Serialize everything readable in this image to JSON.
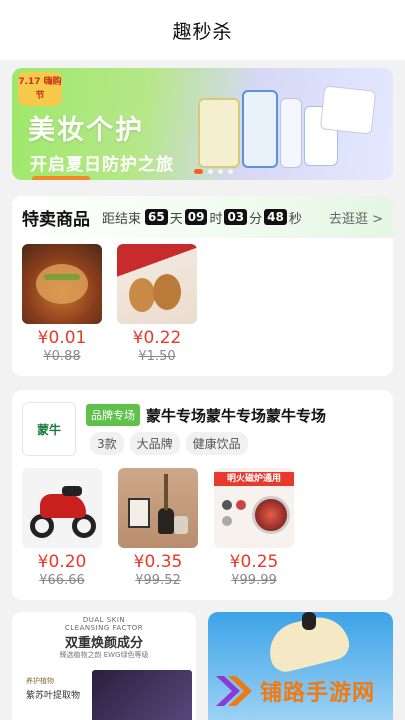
{
  "header": {
    "title": "趣秒杀"
  },
  "banner": {
    "tag": "7.17 嗨购节",
    "headline": "美妆个护",
    "subline": "开启夏日防护之旅"
  },
  "flash_sale": {
    "title": "特卖商品",
    "ends_in_label": "距结束",
    "days": "65",
    "days_unit": "天",
    "hours": "09",
    "hours_unit": "时",
    "minutes": "03",
    "minutes_unit": "分",
    "seconds": "48",
    "seconds_unit": "秒",
    "more_label": "去逛逛 >",
    "products": [
      {
        "price": "¥0.01",
        "original": "¥0.88"
      },
      {
        "price": "¥0.22",
        "original": "¥1.50"
      }
    ]
  },
  "brand_block": {
    "logo_text": "蒙牛",
    "badge": "品牌专场",
    "name": "蒙牛专场蒙牛专场蒙牛专场",
    "chips": [
      "3款",
      "大品牌",
      "健康饮品"
    ],
    "products": [
      {
        "price": "¥0.20",
        "original": "¥66.66"
      },
      {
        "price": "¥0.35",
        "original": "¥99.52"
      },
      {
        "price": "¥0.25",
        "original": "¥99.99",
        "image_text": "明火磁炉通用"
      }
    ]
  },
  "promo_card": {
    "top_line1": "DUAL SKIN",
    "top_line2": "CLEANSING FACTOR",
    "title": "双重焕颜成分",
    "subtitle": "臻选植物之韵 EWG绿色等级",
    "label1": "养护植物",
    "label2": "紫苏叶提取物"
  },
  "watermark": {
    "text": "铺路手游网"
  },
  "colors": {
    "price": "#e8392c",
    "badge": "#5fc04a",
    "accent": "#f07a12"
  }
}
